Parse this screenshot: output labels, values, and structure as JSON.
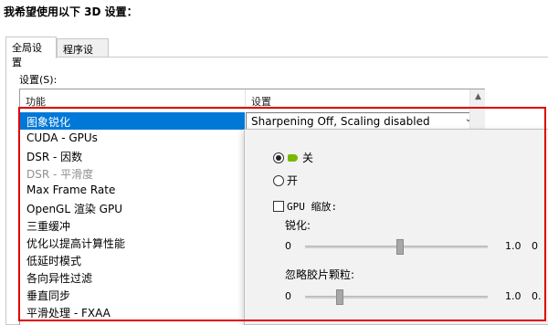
{
  "heading": "我希望使用以下 3D 设置：",
  "tabs": [
    {
      "label": "全局设置",
      "active": true
    },
    {
      "label": "程序设置",
      "active": false
    }
  ],
  "settings_label": "设置(S):",
  "columns": {
    "feature": "功能",
    "setting": "设置"
  },
  "rows": [
    {
      "label": "图象锐化",
      "state": "selected"
    },
    {
      "label": "CUDA - GPUs",
      "state": "normal"
    },
    {
      "label": "DSR - 因数",
      "state": "normal"
    },
    {
      "label": "DSR - 平滑度",
      "state": "disabled"
    },
    {
      "label": "Max Frame Rate",
      "state": "normal"
    },
    {
      "label": "OpenGL 渲染 GPU",
      "state": "normal"
    },
    {
      "label": "三重缓冲",
      "state": "normal"
    },
    {
      "label": "优化以提高计算性能",
      "state": "normal"
    },
    {
      "label": "低延时模式",
      "state": "normal"
    },
    {
      "label": "各向异性过滤",
      "state": "normal"
    },
    {
      "label": "垂直同步",
      "state": "normal"
    },
    {
      "label": "平滑处理 - FXAA",
      "state": "normal"
    }
  ],
  "selected_value": "Sharpening Off, Scaling disabled",
  "dropdown": {
    "option_off": "关",
    "option_on": "开",
    "gpu_scaling": "GPU 缩放:",
    "sharpen": {
      "title": "锐化:",
      "min": "0",
      "max": "1.0",
      "extra": "0",
      "level": 0.52
    },
    "grain": {
      "title": "忽略胶片颗粒:",
      "min": "0",
      "max": "1.0",
      "extra": "0.",
      "level": 0.19
    }
  },
  "colors": {
    "selection": "#0078d7",
    "annotation": "#e00000",
    "nvidia": "#76b900"
  }
}
